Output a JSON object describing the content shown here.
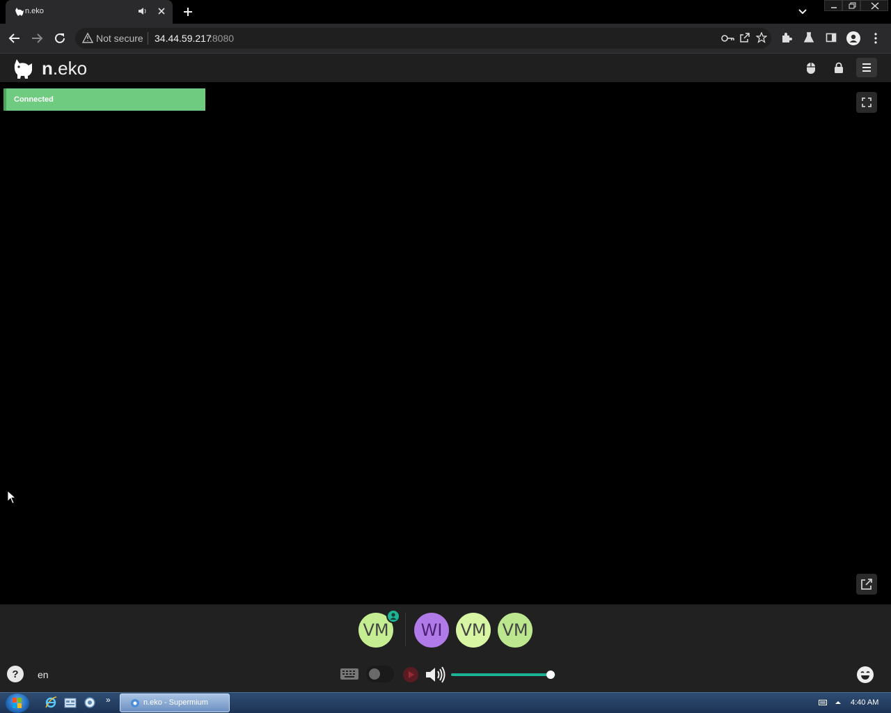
{
  "browser": {
    "tab_title": "n.eko",
    "security_text": "Not secure",
    "url_host": "34.44.59.217",
    "url_port": ":8080"
  },
  "neko": {
    "logo_bold": "n",
    "logo_rest": ".eko",
    "connected_text": "Connected",
    "members": [
      {
        "initials": "VM",
        "color": "#c5ee92",
        "is_host": true
      },
      {
        "initials": "WI",
        "color": "#b07ae8",
        "is_host": false
      },
      {
        "initials": "VM",
        "color": "#d7f5a2",
        "is_host": false
      },
      {
        "initials": "VM",
        "color": "#bce78e",
        "is_host": false
      }
    ],
    "help_label": "?",
    "language": "en",
    "volume_fraction": 0.95,
    "accent_color": "#1bb394"
  },
  "taskbar": {
    "active_window": "n.eko - Supermium",
    "clock": "4:40 AM"
  },
  "icons": [
    "neko-cat-icon",
    "speaker-icon",
    "close-icon",
    "plus-icon",
    "chevron-down-icon",
    "back-arrow-icon",
    "forward-arrow-icon",
    "reload-icon",
    "warning-triangle-icon",
    "key-icon",
    "share-icon",
    "star-icon",
    "puzzle-icon",
    "flask-icon",
    "sidepanel-icon",
    "profile-icon",
    "kebab-menu-icon",
    "mouse-icon",
    "lock-icon",
    "hamburger-menu-icon",
    "fullscreen-icon",
    "popout-icon",
    "keyboard-icon",
    "record-icon",
    "volume-icon",
    "emoji-icon",
    "windows-start-icon"
  ]
}
